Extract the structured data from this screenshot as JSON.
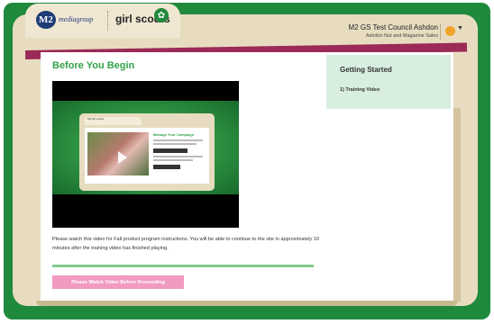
{
  "header": {
    "logo_m2": "M2",
    "logo_media": "mediagroup",
    "logo_gs": "girl scouts",
    "council_name": "M2 GS Test Council Ashdon",
    "subtitle": "Ashdon Nut and Magazine Sales",
    "user_menu_icon": "user-circle-icon"
  },
  "main": {
    "title": "Before You Begin",
    "video": {
      "preview_logo_m2": "M2",
      "preview_logo_gs": "girl scouts",
      "preview_heading": "Manage Your Campaign"
    },
    "instructions": "Please watch this video for Fall product program instructions. You will be able to continue to the site in approximately 10 minutes after the training video has finished playing.",
    "proceed_button": "Please Watch Video Before Proceeding"
  },
  "sidebar": {
    "title": "Getting Started",
    "items": [
      {
        "label": "1) Training Video"
      }
    ]
  },
  "colors": {
    "frame_green": "#1f8a3c",
    "title_green": "#33a24a",
    "accent_magenta": "#9b2a57",
    "button_pink": "#f19ac2",
    "sidebar_bg": "#d8efe0"
  }
}
